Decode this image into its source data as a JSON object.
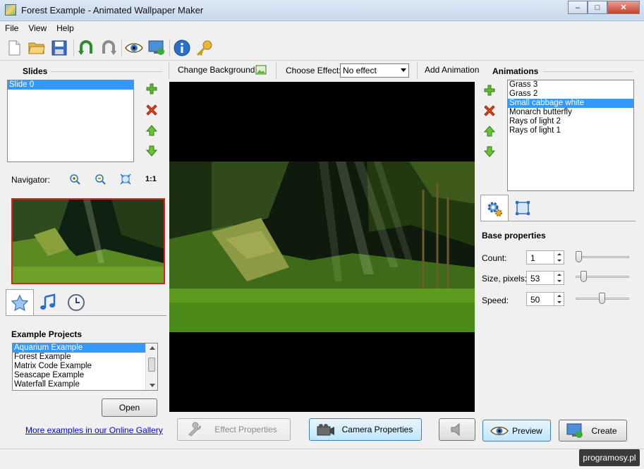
{
  "window": {
    "title": "Forest Example - Animated Wallpaper Maker"
  },
  "menu": [
    "File",
    "View",
    "Help"
  ],
  "toolbar_icons": [
    "new-file-icon",
    "open-folder-icon",
    "save-icon",
    "undo-icon",
    "redo-icon",
    "preview-eye-icon",
    "export-screen-icon",
    "info-icon",
    "key-icon"
  ],
  "slides": {
    "title": "Slides",
    "items": [
      "Slide 0"
    ],
    "selected_index": 0
  },
  "navigator": {
    "label": "Navigator:",
    "actual_size_label": "1:1"
  },
  "left_tabs": [
    "star-icon",
    "music-note-icon",
    "clock-icon"
  ],
  "examples": {
    "title": "Example Projects",
    "items": [
      "Aquarium Example",
      "Forest Example",
      "Matrix Code Example",
      "Seascape Example",
      "Waterfall Example"
    ],
    "selected_index": 0,
    "open_label": "Open",
    "gallery_link": "More examples in our Online Gallery"
  },
  "center": {
    "change_background": "Change Background",
    "choose_effect_label": "Choose Effect:",
    "effect_value": "No effect",
    "add_animation": "Add Animation"
  },
  "animations": {
    "title": "Animations",
    "items": [
      "Grass 3",
      "Grass 2",
      "Small cabbage white",
      "Monarch butterfly",
      "Rays of light 2",
      "Rays of light 1"
    ],
    "selected_index": 2
  },
  "properties": {
    "title": "Base properties",
    "count": {
      "label": "Count:",
      "value": "1",
      "slider_fraction": 0.0
    },
    "size": {
      "label": "Size, pixels:",
      "value": "53",
      "slider_fraction": 0.1
    },
    "speed": {
      "label": "Speed:",
      "value": "50",
      "slider_fraction": 0.5
    }
  },
  "bottom": {
    "effect_properties": "Effect Properties",
    "camera_properties": "Camera Properties",
    "preview": "Preview",
    "create": "Create"
  },
  "watermark": "programosy.pl",
  "colors": {
    "selection": "#3399ff",
    "thumb_border": "#e02020",
    "canvas_bg": "#000000"
  }
}
